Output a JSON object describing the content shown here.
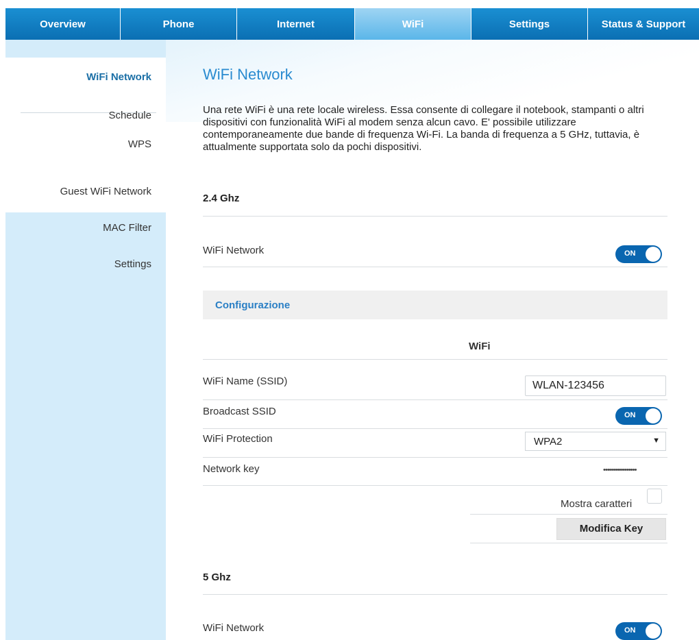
{
  "topnav": {
    "tabs": [
      {
        "label": "Overview"
      },
      {
        "label": "Phone"
      },
      {
        "label": "Internet"
      },
      {
        "label": "WiFi"
      },
      {
        "label": "Settings"
      },
      {
        "label": "Status & Support"
      }
    ],
    "active_index": 3
  },
  "sidebar": {
    "items": [
      {
        "label": "WiFi Network"
      },
      {
        "label": "Schedule"
      },
      {
        "label": "WPS"
      },
      {
        "label": "Guest WiFi Network"
      },
      {
        "label": "MAC Filter"
      },
      {
        "label": "Settings"
      }
    ]
  },
  "main": {
    "title": "WiFi Network",
    "intro": "Una rete WiFi è una rete locale wireless. Essa consente di collegare il notebook, stampanti o altri dispositivi con funzionalità WiFi al modem senza alcun cavo. E' possibile utilizzare contemporaneamente due bande di frequenza Wi-Fi. La banda di frequenza a 5 GHz, tuttavia, è attualmente supportata solo da pochi dispositivi.",
    "band24": {
      "title": "2.4 Ghz",
      "wifi_label": "WiFi Network",
      "wifi_toggle": "ON"
    },
    "config": {
      "title": "Configurazione",
      "column_header": "WiFi",
      "ssid_label": "WiFi Name (SSID)",
      "ssid_value": "WLAN-123456",
      "broadcast_label": "Broadcast SSID",
      "broadcast_toggle": "ON",
      "protection_label": "WiFi Protection",
      "protection_value": "WPA2",
      "key_label": "Network key",
      "key_value": "•••••••••••••••••",
      "show_chars_label": "Mostra caratteri",
      "modify_key_label": "Modifica Key"
    },
    "band5": {
      "title": "5 Ghz",
      "wifi_label": "WiFi Network",
      "wifi_toggle": "ON"
    }
  },
  "colors": {
    "nav_blue": "#0e7fc4",
    "nav_active": "#5bb6e9",
    "sidebar_bg": "#d4ecfa",
    "title_blue": "#2a8bd0",
    "toggle_blue": "#0a66b0"
  }
}
